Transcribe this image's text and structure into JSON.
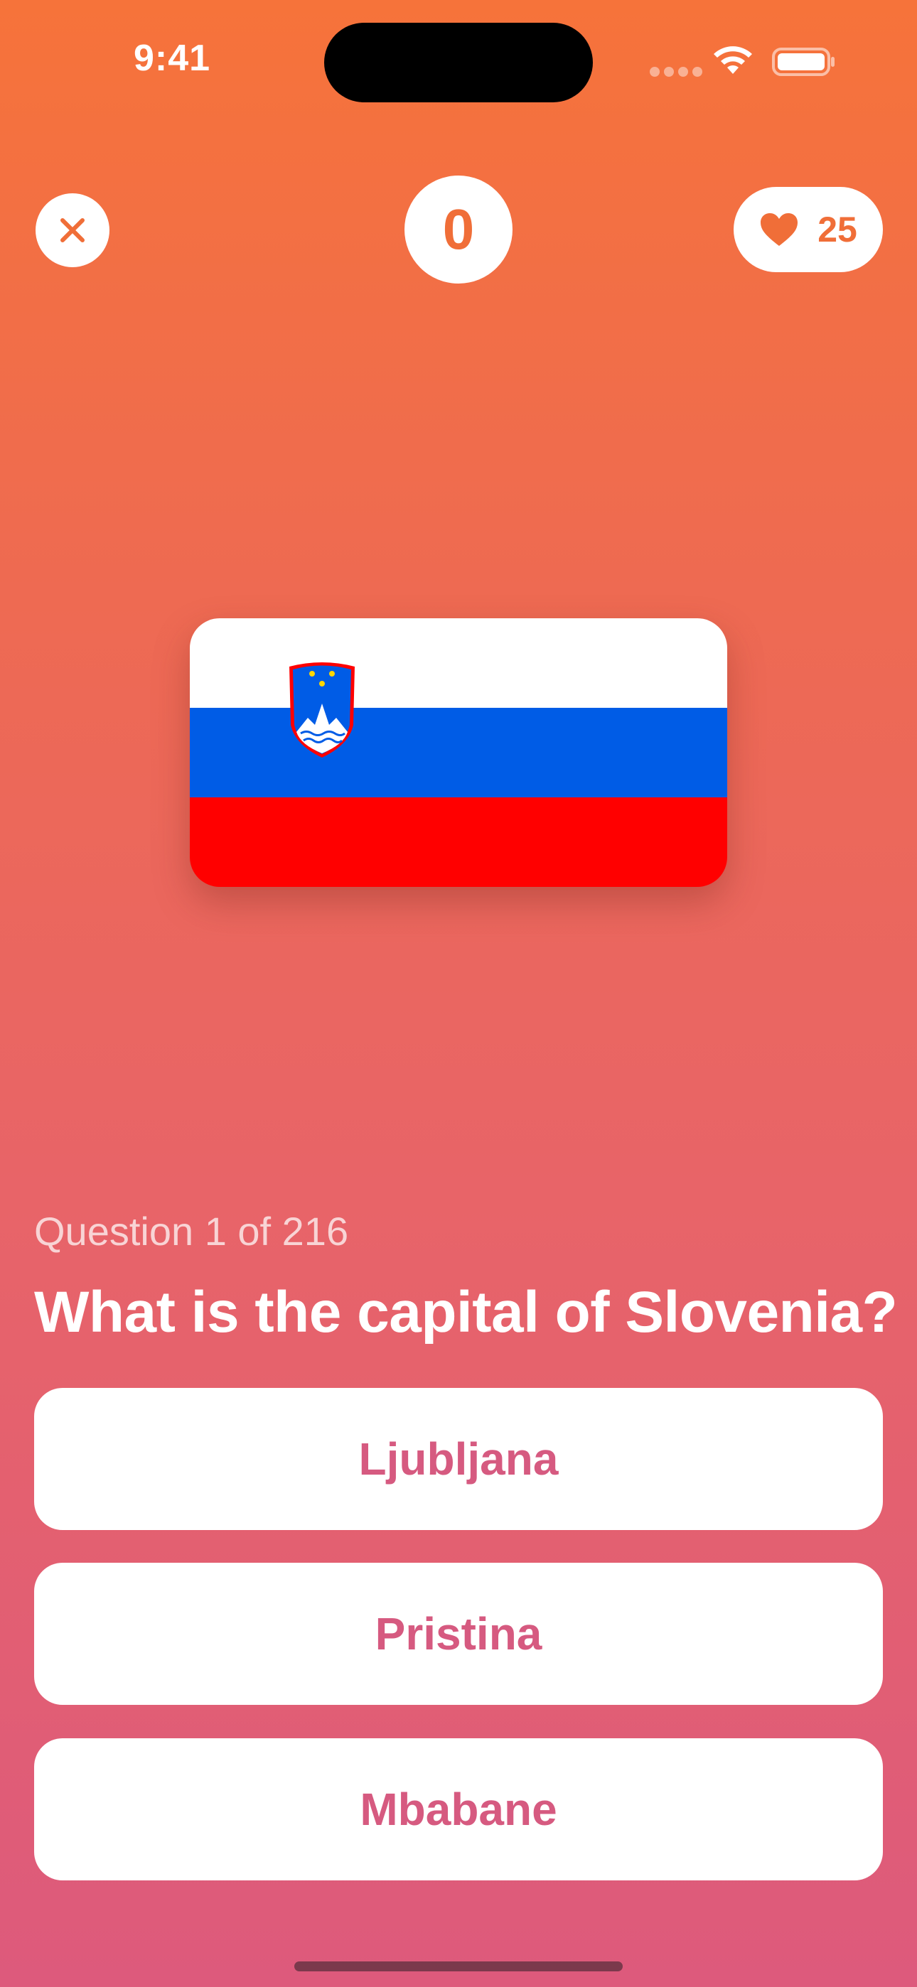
{
  "status_bar": {
    "time": "9:41"
  },
  "header": {
    "close_icon": "close-x-icon",
    "score": "0",
    "lives_icon": "heart-icon",
    "lives": "25"
  },
  "flag": {
    "country": "Slovenia",
    "colors": {
      "white": "#ffffff",
      "blue": "#005ce6",
      "red": "#ff0000"
    }
  },
  "question": {
    "counter": "Question 1 of 216",
    "text": "What is the capital of Slovenia?"
  },
  "answers": [
    {
      "label": "Ljubljana"
    },
    {
      "label": "Pristina"
    },
    {
      "label": "Mbabane"
    }
  ],
  "theme": {
    "accent": "#f06e38",
    "answer_text": "#d65a80",
    "gradient_top": "#f6733a",
    "gradient_bottom": "#dd5a7c"
  }
}
